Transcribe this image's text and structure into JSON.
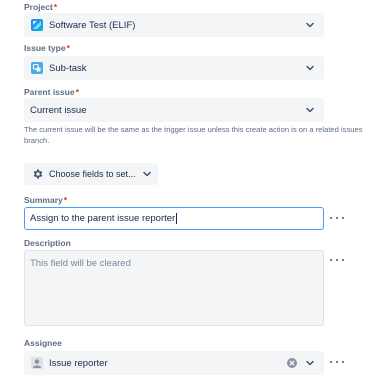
{
  "required_marker": "*",
  "project": {
    "label": "Project",
    "value": "Software Test (ELIF)",
    "icon": "project-icon"
  },
  "issue_type": {
    "label": "Issue type",
    "value": "Sub-task",
    "icon": "subtask-icon"
  },
  "parent_issue": {
    "label": "Parent issue",
    "value": "Current issue",
    "help_text": "The current issue will be the same as the trigger issue unless this create action is on a related issues branch."
  },
  "choose_fields": {
    "label": "Choose fields to set...",
    "icon": "gear-icon"
  },
  "summary": {
    "label": "Summary",
    "value": "Assign to the parent issue reporter"
  },
  "description": {
    "label": "Description",
    "placeholder": "This field will be cleared"
  },
  "assignee": {
    "label": "Assignee",
    "value": "Issue reporter",
    "icon": "avatar-icon"
  },
  "colors": {
    "accent": "#4c9aff",
    "required": "#de350b",
    "field_bg": "#f4f5f7",
    "label": "#5e6c84"
  }
}
